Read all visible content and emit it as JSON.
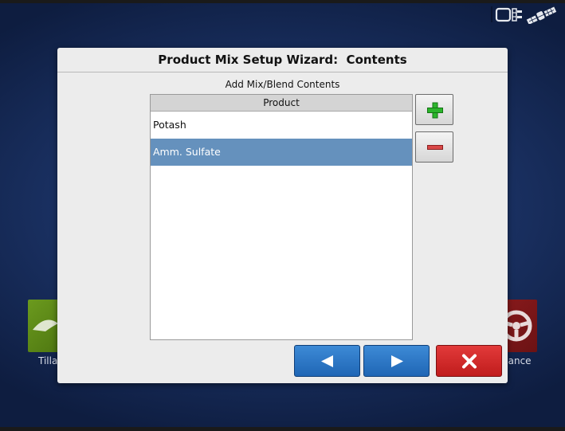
{
  "dialog": {
    "title": "Product Mix Setup Wizard:  Contents",
    "subtitle": "Add Mix/Blend Contents"
  },
  "product_list": {
    "header": "Product",
    "rows": [
      {
        "label": "Potash",
        "selected": false
      },
      {
        "label": "Amm. Sulfate",
        "selected": true
      }
    ]
  },
  "side_buttons": {
    "add_icon": "plus-icon",
    "remove_icon": "minus-icon"
  },
  "nav_buttons": {
    "back_icon": "arrow-left-icon",
    "next_icon": "arrow-right-icon",
    "cancel_icon": "close-icon"
  },
  "home_tiles": [
    {
      "label": "Tilla",
      "icon": "tillage-icon",
      "color": "#5e8a18"
    },
    {
      "label": "dance",
      "icon": "steering-wheel-icon",
      "color": "#7d1719"
    }
  ],
  "status_icons": [
    "display-module-icon",
    "gps-satellite-icon"
  ],
  "colors": {
    "accent_blue": "#2a76c6",
    "cancel_red": "#d42a2a",
    "selected_row": "#6591bd",
    "add_green": "#2cb52c",
    "remove_red": "#d94848"
  }
}
